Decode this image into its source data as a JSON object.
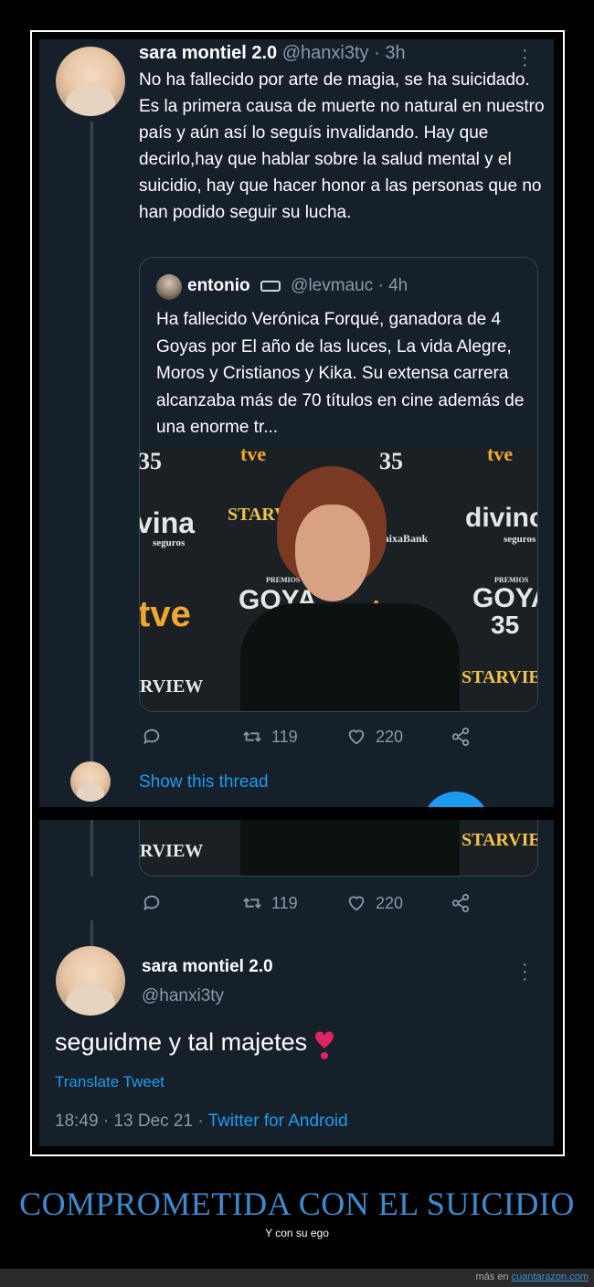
{
  "tweet1": {
    "display_name": "sara montiel 2.0",
    "handle_time": "@hanxi3ty · 3h",
    "text": "No ha fallecido por arte de magia, se ha suicidado. Es la primera causa de muerte no natural en nuestro país y aún así lo seguís invalidando. Hay que decirlo,hay que hablar sobre la salud mental y el suicidio, hay que hacer honor a las personas que no han podido seguir su lucha.",
    "quote": {
      "display_name": "entonio",
      "handle_time": "@levmauc · 4h",
      "text": "Ha fallecido Verónica Forqué, ganadora de 4 Goyas por El año de las luces, La vida Alegre, Moros y Cristianos y Kika. Su extensa carrera alcanzaba más de 70 títulos en cine además de una enorme tr...",
      "photo_backdrop": [
        "35",
        "tve",
        "35",
        "tve",
        "vina",
        "seguros",
        "STARVIEW",
        "CaixaBank",
        "divino",
        "seguros",
        "tve",
        "GOYA",
        "35",
        "tve",
        "GOYA",
        "35",
        "RVIEW",
        "STARVIEW",
        "PREMIOS",
        "PREMIOS"
      ]
    },
    "retweets": "119",
    "likes": "220",
    "show_thread": "Show this thread"
  },
  "tweet2": {
    "photo_backdrop": [
      "RVIEW",
      "STARVIEW"
    ],
    "retweets": "119",
    "likes": "220",
    "display_name": "sara montiel 2.0",
    "handle": "@hanxi3ty",
    "text": "seguidme y tal majetes",
    "emoji": "heavy-heart-exclamation",
    "translate": "Translate Tweet",
    "timestamp": "18:49 · 13 Dec 21 · ",
    "source": "Twitter for Android"
  },
  "caption": {
    "title": "COMPROMETIDA CON EL SUICIDIO",
    "subtitle": "Y con su ego"
  },
  "footer": {
    "prefix": "más en ",
    "site": "cuantarazon.com"
  },
  "colors": {
    "tweet_bg": "#15202b",
    "accent": "#1d9bf0",
    "muted": "#8b98a5",
    "caption": "#3c8bd0",
    "heart": "#e0245e"
  }
}
